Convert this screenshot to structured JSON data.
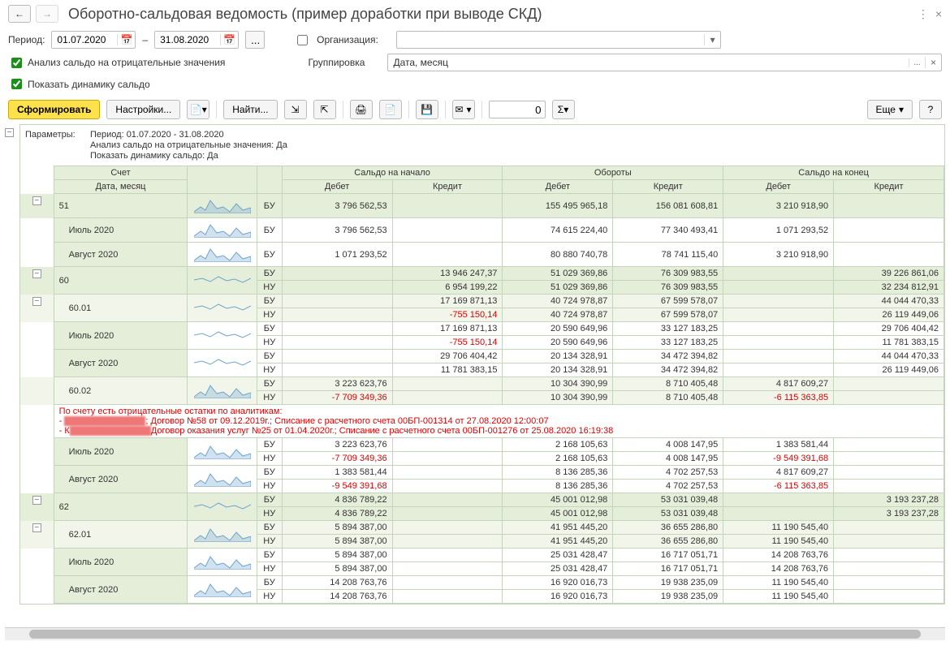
{
  "header": {
    "title": "Оборотно-сальдовая ведомость (пример доработки при выводе СКД)"
  },
  "filters": {
    "period_label": "Период:",
    "date_from": "01.07.2020",
    "date_sep": "–",
    "date_to": "31.08.2020",
    "org_label": "Организация:",
    "org_value": "",
    "chk1_label": "Анализ сальдо на отрицательные значения",
    "chk2_label": "Показать динамику сальдо",
    "grp_label": "Группировка",
    "grp_value": "Дата, месяц"
  },
  "toolbar": {
    "main": "Сформировать",
    "settings": "Настройки...",
    "find": "Найти...",
    "num_value": "0",
    "more": "Еще",
    "help": "?"
  },
  "params": {
    "label": "Параметры:",
    "lines": [
      "Период: 01.07.2020 - 31.08.2020",
      "Анализ сальдо на отрицательные значения: Да",
      "Показать динамику сальдо: Да"
    ]
  },
  "headers": {
    "acct": "Счет",
    "date": "Дата, месяц",
    "start": "Сальдо на начало",
    "turn": "Обороты",
    "end": "Сальдо на конец",
    "deb": "Дебет",
    "cred": "Кредит"
  },
  "rows": [
    {
      "cls": "row-green",
      "tree": "m",
      "acc": "51",
      "spark": "area",
      "sub": [
        {
          "bu": "БУ",
          "c": [
            "3 796 562,53",
            "",
            "155 495 965,18",
            "156 081 608,81",
            "3 210 918,90",
            ""
          ]
        }
      ]
    },
    {
      "cls": "",
      "acc": "Июль 2020",
      "indent": 1,
      "spark": "area",
      "sub": [
        {
          "bu": "БУ",
          "c": [
            "3 796 562,53",
            "",
            "74 615 224,40",
            "77 340 493,41",
            "1 071 293,52",
            ""
          ]
        }
      ]
    },
    {
      "cls": "",
      "acc": "Август 2020",
      "indent": 1,
      "spark": "area",
      "sub": [
        {
          "bu": "БУ",
          "c": [
            "1 071 293,52",
            "",
            "80 880 740,78",
            "78 741 115,40",
            "3 210 918,90",
            ""
          ]
        }
      ]
    },
    {
      "cls": "row-green",
      "tree": "m",
      "acc": "60",
      "spark": "line",
      "sub": [
        {
          "bu": "БУ",
          "c": [
            "",
            "13 946 247,37",
            "51 029 369,86",
            "76 309 983,55",
            "",
            "39 226 861,06"
          ]
        },
        {
          "bu": "НУ",
          "c": [
            "",
            "6 954 199,22",
            "51 029 369,86",
            "76 309 983,55",
            "",
            "32 234 812,91"
          ]
        }
      ]
    },
    {
      "cls": "row-sub",
      "tree": "m",
      "acc": "60.01",
      "indent": 1,
      "spark": "line",
      "sub": [
        {
          "bu": "БУ",
          "c": [
            "",
            "17 169 871,13",
            "40 724 978,87",
            "67 599 578,07",
            "",
            "44 044 470,33"
          ]
        },
        {
          "bu": "НУ",
          "c": [
            "",
            "-755 150,14",
            "40 724 978,87",
            "67 599 578,07",
            "",
            "26 119 449,06"
          ],
          "neg": [
            1
          ]
        }
      ]
    },
    {
      "cls": "",
      "acc": "Июль 2020",
      "indent": 1,
      "spark": "line",
      "sub": [
        {
          "bu": "БУ",
          "c": [
            "",
            "17 169 871,13",
            "20 590 649,96",
            "33 127 183,25",
            "",
            "29 706 404,42"
          ]
        },
        {
          "bu": "НУ",
          "c": [
            "",
            "-755 150,14",
            "20 590 649,96",
            "33 127 183,25",
            "",
            "11 781 383,15"
          ],
          "neg": [
            1
          ]
        }
      ]
    },
    {
      "cls": "",
      "acc": "Август 2020",
      "indent": 1,
      "spark": "line",
      "sub": [
        {
          "bu": "БУ",
          "c": [
            "",
            "29 706 404,42",
            "20 134 328,91",
            "34 472 394,82",
            "",
            "44 044 470,33"
          ]
        },
        {
          "bu": "НУ",
          "c": [
            "",
            "11 781 383,15",
            "20 134 328,91",
            "34 472 394,82",
            "",
            "26 119 449,06"
          ]
        }
      ]
    },
    {
      "cls": "row-sub",
      "acc": "60.02",
      "indent": 1,
      "spark": "area",
      "sub": [
        {
          "bu": "БУ",
          "c": [
            "3 223 623,76",
            "",
            "10 304 390,99",
            "8 710 405,48",
            "4 817 609,27",
            ""
          ]
        },
        {
          "bu": "НУ",
          "c": [
            "-7 709 349,36",
            "",
            "10 304 390,99",
            "8 710 405,48",
            "-6 115 363,85",
            ""
          ],
          "neg": [
            0,
            4
          ]
        }
      ]
    },
    {
      "cls": "warn-row",
      "warn": true,
      "lines": [
        "По счету есть отрицательные остатки по аналитикам:",
        "; Договор №58 от 09.12.2019г.; Списание с расчетного счета 00БП-001314 от 27.08.2020 12:00:07",
        "Договор оказания услуг №25 от 01.04.2020г.; Списание с расчетного счета 00БП-001276 от 25.08.2020 16:19:38"
      ],
      "prefix": [
        "",
        "-   ",
        "- К"
      ]
    },
    {
      "cls": "",
      "acc": "Июль 2020",
      "indent": 1,
      "spark": "area",
      "sub": [
        {
          "bu": "БУ",
          "c": [
            "3 223 623,76",
            "",
            "2 168 105,63",
            "4 008 147,95",
            "1 383 581,44",
            ""
          ]
        },
        {
          "bu": "НУ",
          "c": [
            "-7 709 349,36",
            "",
            "2 168 105,63",
            "4 008 147,95",
            "-9 549 391,68",
            ""
          ],
          "neg": [
            0,
            4
          ]
        }
      ]
    },
    {
      "cls": "",
      "acc": "Август 2020",
      "indent": 1,
      "spark": "area",
      "sub": [
        {
          "bu": "БУ",
          "c": [
            "1 383 581,44",
            "",
            "8 136 285,36",
            "4 702 257,53",
            "4 817 609,27",
            ""
          ]
        },
        {
          "bu": "НУ",
          "c": [
            "-9 549 391,68",
            "",
            "8 136 285,36",
            "4 702 257,53",
            "-6 115 363,85",
            ""
          ],
          "neg": [
            0,
            4
          ]
        }
      ]
    },
    {
      "cls": "row-green",
      "tree": "m",
      "acc": "62",
      "spark": "line",
      "sub": [
        {
          "bu": "БУ",
          "c": [
            "4 836 789,22",
            "",
            "45 001 012,98",
            "53 031 039,48",
            "",
            "3 193 237,28"
          ]
        },
        {
          "bu": "НУ",
          "c": [
            "4 836 789,22",
            "",
            "45 001 012,98",
            "53 031 039,48",
            "",
            "3 193 237,28"
          ]
        }
      ]
    },
    {
      "cls": "row-sub",
      "tree": "m",
      "acc": "62.01",
      "indent": 1,
      "spark": "area",
      "sub": [
        {
          "bu": "БУ",
          "c": [
            "5 894 387,00",
            "",
            "41 951 445,20",
            "36 655 286,80",
            "11 190 545,40",
            ""
          ]
        },
        {
          "bu": "НУ",
          "c": [
            "5 894 387,00",
            "",
            "41 951 445,20",
            "36 655 286,80",
            "11 190 545,40",
            ""
          ]
        }
      ]
    },
    {
      "cls": "",
      "acc": "Июль 2020",
      "indent": 1,
      "spark": "area",
      "sub": [
        {
          "bu": "БУ",
          "c": [
            "5 894 387,00",
            "",
            "25 031 428,47",
            "16 717 051,71",
            "14 208 763,76",
            ""
          ]
        },
        {
          "bu": "НУ",
          "c": [
            "5 894 387,00",
            "",
            "25 031 428,47",
            "16 717 051,71",
            "14 208 763,76",
            ""
          ]
        }
      ]
    },
    {
      "cls": "",
      "acc": "Август 2020",
      "indent": 1,
      "spark": "area",
      "sub": [
        {
          "bu": "БУ",
          "c": [
            "14 208 763,76",
            "",
            "16 920 016,73",
            "19 938 235,09",
            "11 190 545,40",
            ""
          ]
        },
        {
          "bu": "НУ",
          "c": [
            "14 208 763,76",
            "",
            "16 920 016,73",
            "19 938 235,09",
            "11 190 545,40",
            ""
          ]
        }
      ]
    }
  ]
}
